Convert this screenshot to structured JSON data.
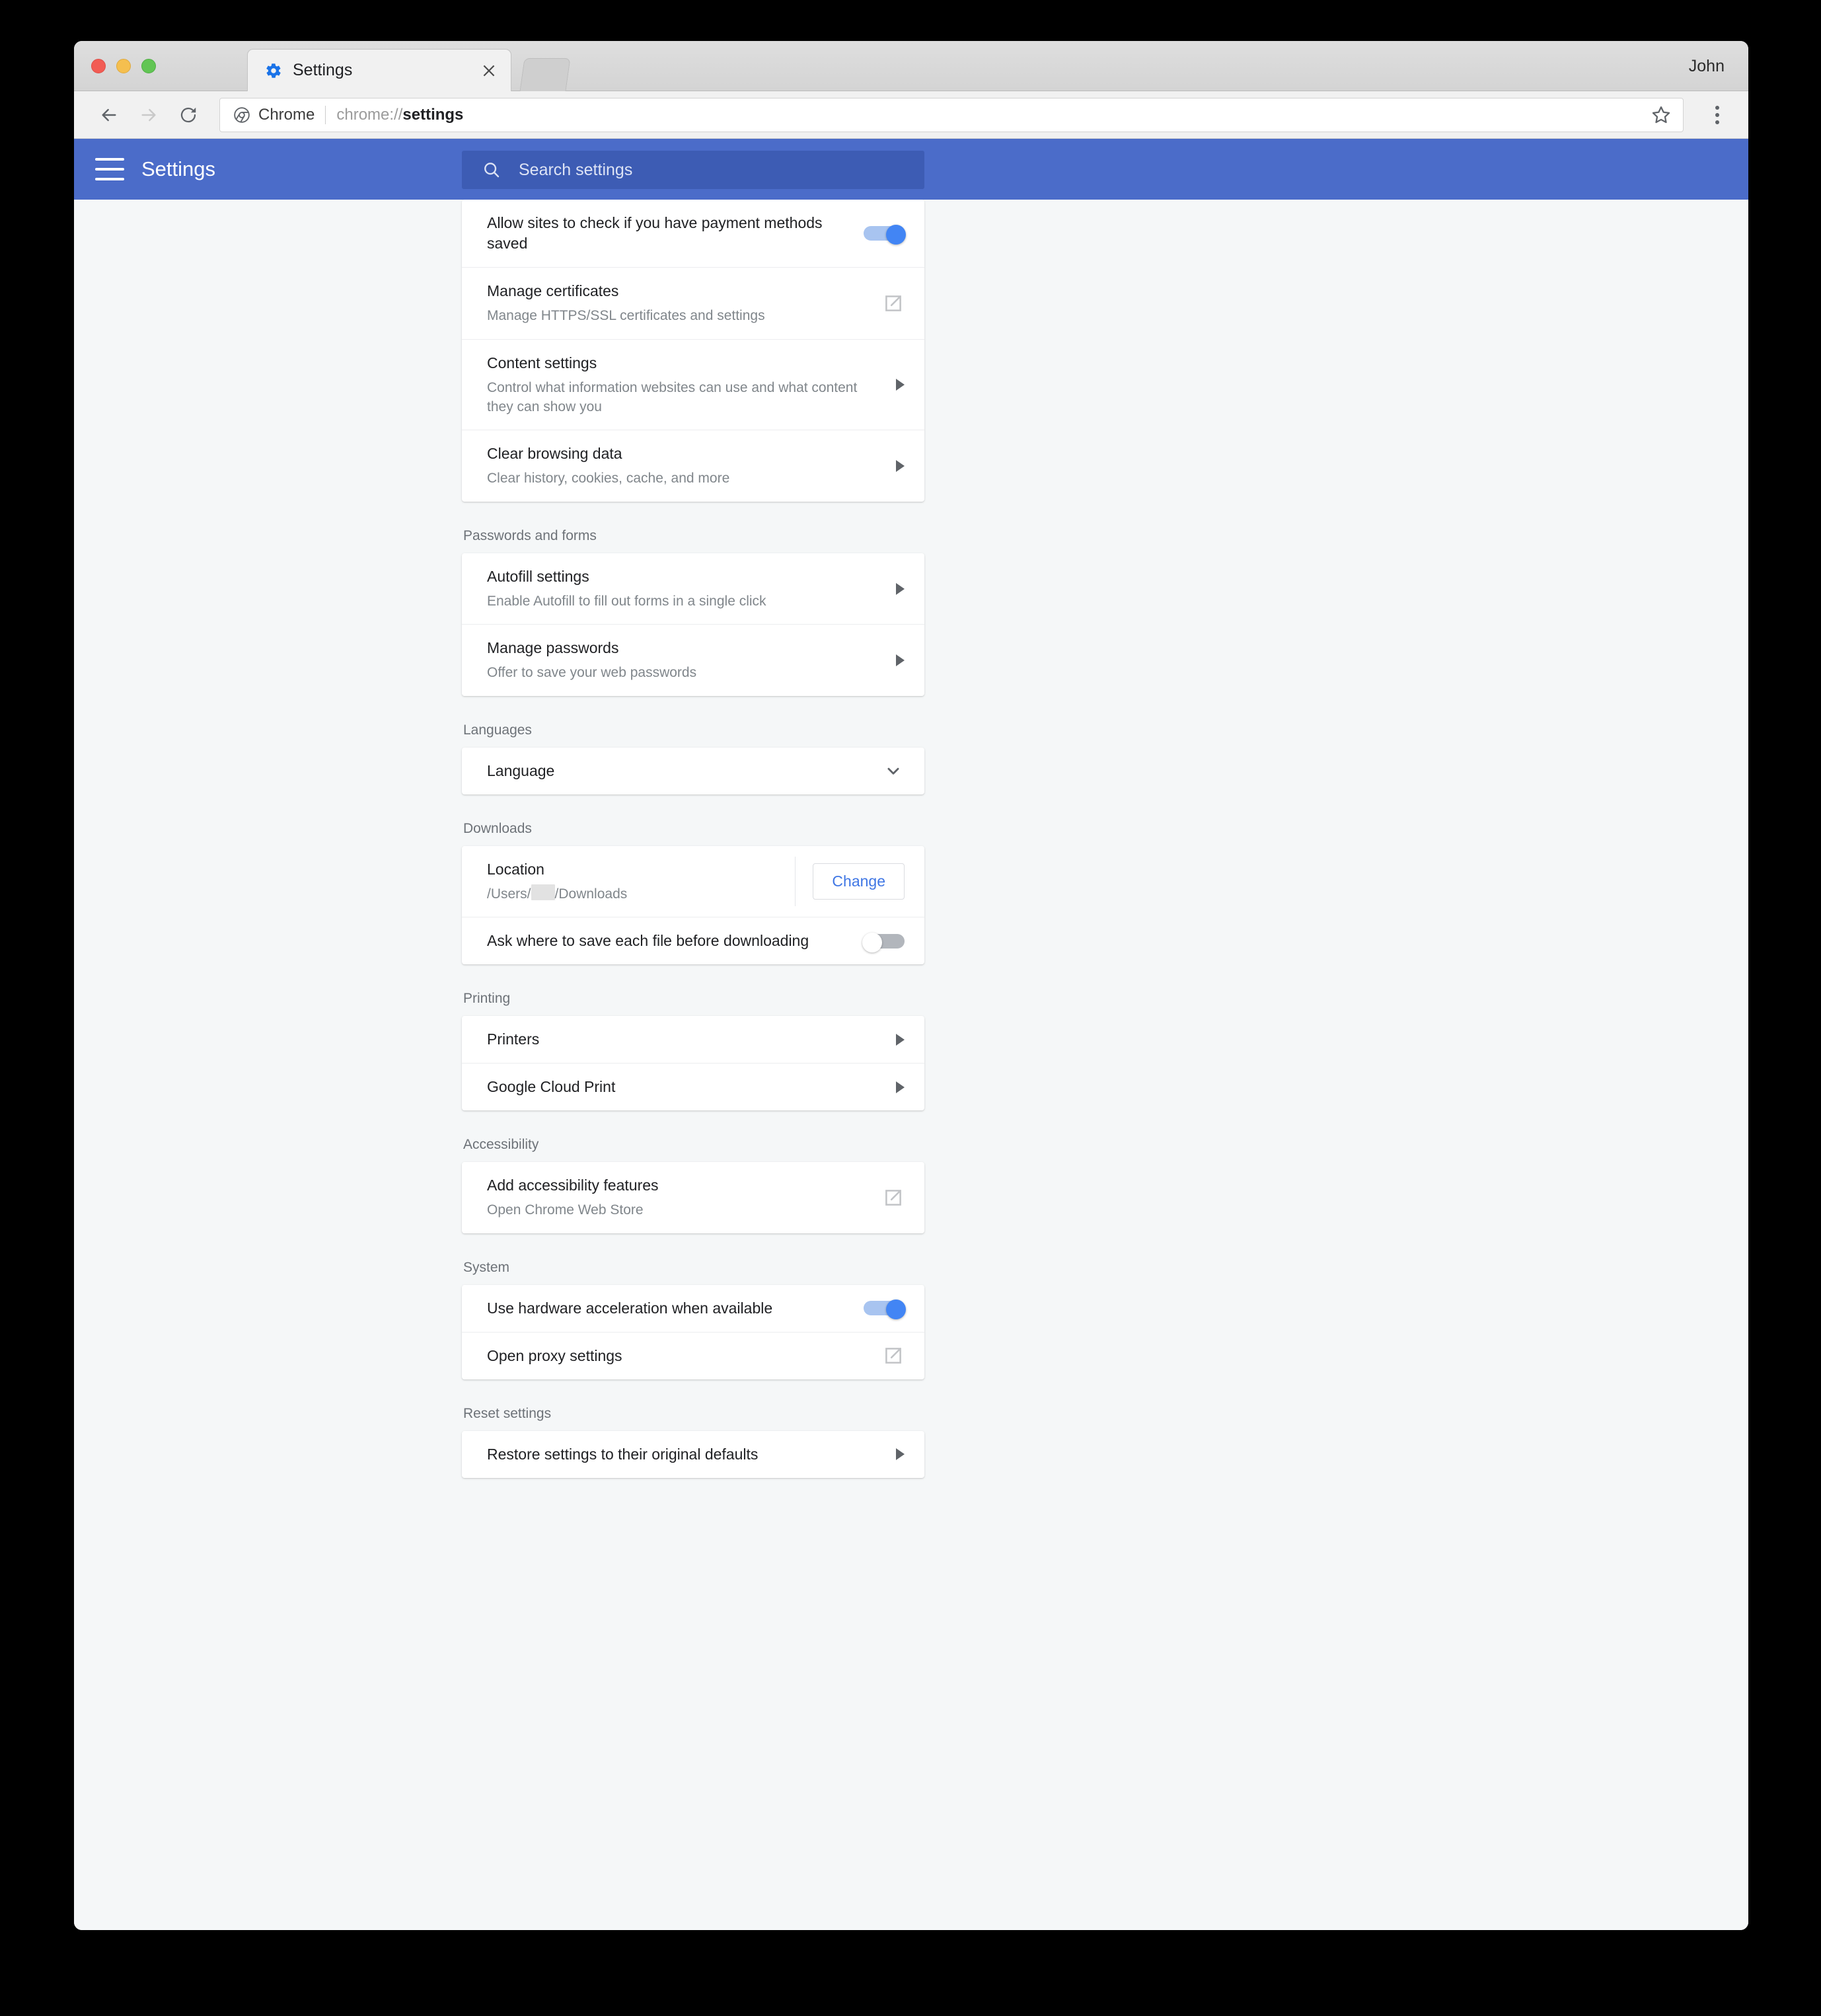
{
  "window": {
    "profile_name": "John",
    "tab": {
      "title": "Settings",
      "favicon": "gear-icon",
      "close": "×"
    },
    "toolbar": {
      "back": "←",
      "forward": "→",
      "reload": "⟳",
      "omnibox_chrome_label": "Chrome",
      "url_prefix": "chrome://",
      "url_emphasis": "settings",
      "url_full": "chrome://settings"
    }
  },
  "header": {
    "menu_icon": "hamburger-icon",
    "title": "Settings",
    "search": {
      "icon": "search-icon",
      "placeholder": "Search settings",
      "value": ""
    }
  },
  "colors": {
    "header_blue": "#4b6cc9",
    "search_blue": "#3d5cb4",
    "toggle_on": "#4285f4",
    "toggle_on_track": "#a8c4f0",
    "toggle_off_track": "#b2b6bc",
    "link_blue": "#3f76e4",
    "page_bg": "#f5f7f8"
  },
  "sections": [
    {
      "label": "",
      "rows": [
        {
          "title": "Allow sites to check if you have payment methods saved",
          "sub": "",
          "control": "toggle",
          "state": "on"
        },
        {
          "title": "Manage certificates",
          "sub": "Manage HTTPS/SSL certificates and settings",
          "control": "external-link"
        },
        {
          "title": "Content settings",
          "sub": "Control what information websites can use and what content they can show you",
          "control": "chevron-right"
        },
        {
          "title": "Clear browsing data",
          "sub": "Clear history, cookies, cache, and more",
          "control": "chevron-right"
        }
      ]
    },
    {
      "label": "Passwords and forms",
      "rows": [
        {
          "title": "Autofill settings",
          "sub": "Enable Autofill to fill out forms in a single click",
          "control": "chevron-right"
        },
        {
          "title": "Manage passwords",
          "sub": "Offer to save your web passwords",
          "control": "chevron-right"
        }
      ]
    },
    {
      "label": "Languages",
      "rows": [
        {
          "title": "Language",
          "sub": "",
          "control": "chevron-down"
        }
      ]
    },
    {
      "label": "Downloads",
      "rows": [
        {
          "title": "Location",
          "sub": "",
          "control": "location",
          "path_prefix": "/Users/",
          "path_suffix": "/Downloads",
          "button_label": "Change"
        },
        {
          "title": "Ask where to save each file before downloading",
          "sub": "",
          "control": "toggle",
          "state": "off"
        }
      ]
    },
    {
      "label": "Printing",
      "rows": [
        {
          "title": "Printers",
          "sub": "",
          "control": "chevron-right"
        },
        {
          "title": "Google Cloud Print",
          "sub": "",
          "control": "chevron-right"
        }
      ]
    },
    {
      "label": "Accessibility",
      "rows": [
        {
          "title": "Add accessibility features",
          "sub": "Open Chrome Web Store",
          "control": "external-link"
        }
      ]
    },
    {
      "label": "System",
      "rows": [
        {
          "title": "Use hardware acceleration when available",
          "sub": "",
          "control": "toggle",
          "state": "on"
        },
        {
          "title": "Open proxy settings",
          "sub": "",
          "control": "external-link"
        }
      ]
    },
    {
      "label": "Reset settings",
      "rows": [
        {
          "title": "Restore settings to their original defaults",
          "sub": "",
          "control": "chevron-right"
        }
      ]
    }
  ]
}
